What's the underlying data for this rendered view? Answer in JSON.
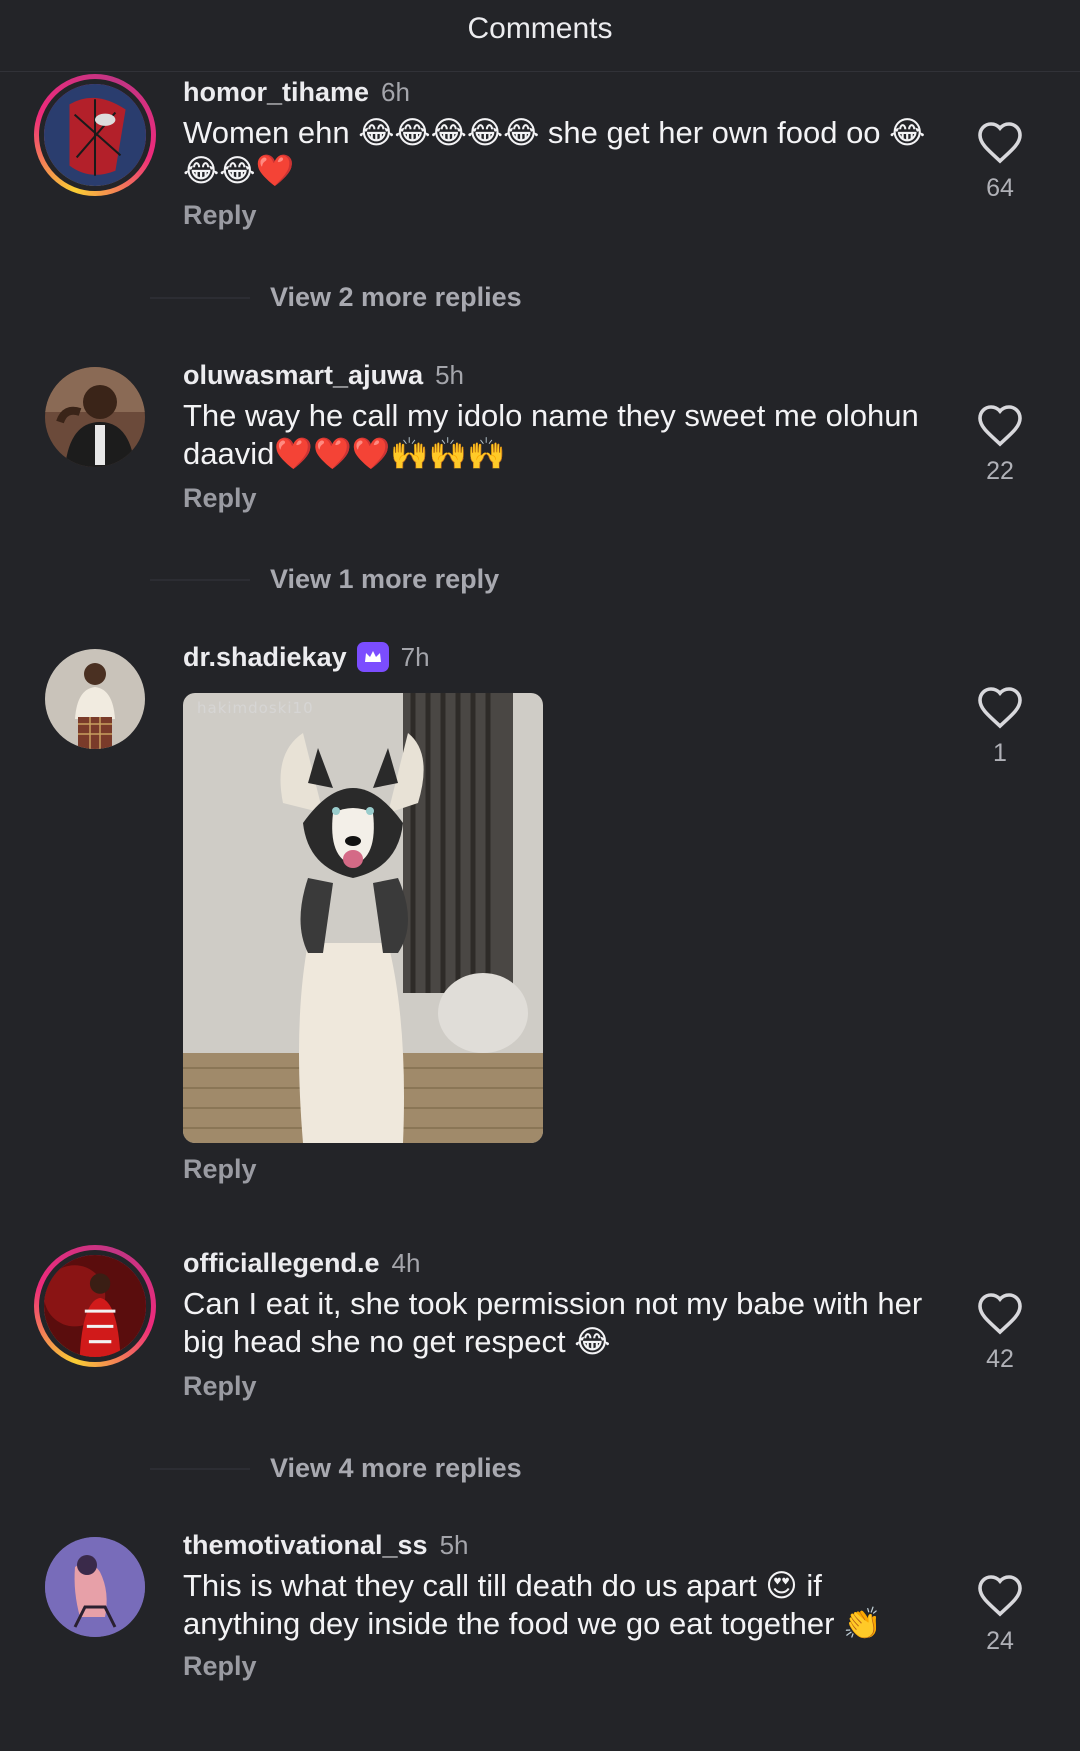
{
  "header": {
    "title": "Comments"
  },
  "comments": [
    {
      "username": "homor_tihame",
      "time": "6h",
      "text": "Women ehn 😂😂😂😂😂 she get her own food oo 😂😂😂❤️",
      "reply": "Reply",
      "likes": "64",
      "view_more": "View 2 more replies",
      "story_ring": true
    },
    {
      "username": "oluwasmart_ajuwa",
      "time": "5h",
      "text": "The way he call my idolo name they sweet me olohun daavid❤️❤️❤️🙌🙌🙌",
      "reply": "Reply",
      "likes": "22",
      "view_more": "View 1 more reply",
      "story_ring": false
    },
    {
      "username": "dr.shadiekay",
      "time": "7h",
      "verified_badge": "crown-badge",
      "gif_watermark": "hakimdoski10",
      "reply": "Reply",
      "likes": "1",
      "story_ring": false
    },
    {
      "username": "officiallegend.e",
      "time": "4h",
      "text": "Can I eat it, she took permission not my babe with her big head she no get respect 😂",
      "reply": "Reply",
      "likes": "42",
      "view_more": "View 4 more replies",
      "story_ring": true
    },
    {
      "username": "themotivational_ss",
      "time": "5h",
      "text": "This is what they call till death do us apart 😍 if anything dey inside the food we go eat together 👏",
      "reply": "Reply",
      "likes": "24",
      "story_ring": false
    }
  ],
  "colors": {
    "background": "#232428",
    "badge": "#7b4dff",
    "ring_start": "#f9ce34",
    "ring_end": "#ee2a7b"
  }
}
